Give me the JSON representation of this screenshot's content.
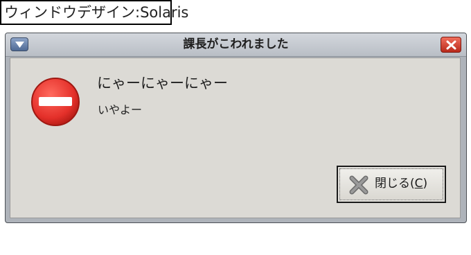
{
  "caption": "ウィンドウデザイン:Solaris",
  "window": {
    "title": "課長がこわれました",
    "menu_icon": "triangle-down-icon",
    "close_icon": "close-icon"
  },
  "dialog": {
    "icon": "error-stop-icon",
    "primary_text": "にゃーにゃーにゃー",
    "secondary_text": "いやよー"
  },
  "close_button": {
    "icon": "x-icon",
    "label_prefix": "閉じる(",
    "mnemonic": "C",
    "label_suffix": ")"
  },
  "colors": {
    "error_red": "#e8322e",
    "close_red": "#c8382a",
    "menu_blue": "#5a75a1",
    "client_bg": "#dcdad5"
  }
}
